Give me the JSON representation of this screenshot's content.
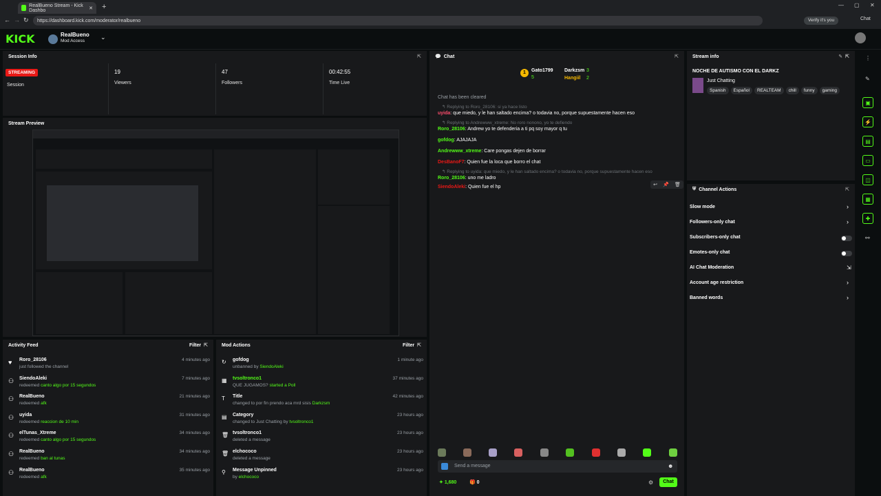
{
  "browser": {
    "tab_title": "RealBueno Stream - Kick Dashbo",
    "url": "https://dashboard.kick.com/moderator/realbueno",
    "verify": "Verify it's you",
    "chat_btn": "Chat"
  },
  "header": {
    "logo": "KICK",
    "channel": "RealBueno",
    "access": "Mod Access"
  },
  "session": {
    "title": "Session Info",
    "status": "STREAMING",
    "status_label": "Session",
    "viewers": "19",
    "viewers_label": "Viewers",
    "followers": "47",
    "followers_label": "Followers",
    "time": "00:42:55",
    "time_label": "Time Live"
  },
  "preview": {
    "title": "Stream Preview"
  },
  "activity": {
    "title": "Activity Feed",
    "filter": "Filter",
    "items": [
      {
        "user": "Roro_28106",
        "action": "just followed the channel",
        "reward": "",
        "time": "4 minutes ago"
      },
      {
        "user": "SiendoAleki",
        "action": "redeemed",
        "reward": "canto algo por 15 segundos",
        "time": "7 minutes ago"
      },
      {
        "user": "RealBueno",
        "action": "redeemed",
        "reward": "afk",
        "time": "21 minutes ago"
      },
      {
        "user": "uyida",
        "action": "redeemed",
        "reward": "reaccion de 10 min",
        "time": "31 minutes ago"
      },
      {
        "user": "elTunas_Xtreme",
        "action": "redeemed",
        "reward": "canto algo por 15 segundos",
        "time": "34 minutes ago"
      },
      {
        "user": "RealBueno",
        "action": "redeemed",
        "reward": "ban al tunas",
        "time": "34 minutes ago"
      },
      {
        "user": "RealBueno",
        "action": "redeemed",
        "reward": "afk",
        "time": "35 minutes ago"
      }
    ]
  },
  "mod": {
    "title": "Mod Actions",
    "filter": "Filter",
    "items": [
      {
        "user": "gofdog",
        "detail": "unbanned by",
        "who": "SiendoAleki",
        "time": "1 minute ago"
      },
      {
        "user": "tvsoltronco1",
        "detail": "QUE JUGAMOS?",
        "who": "started a Poll",
        "time": "37 minutes ago"
      },
      {
        "user": "Title",
        "detail": "changed to por fin prendo aca mrd sisis",
        "who": "Darkzsm",
        "time": "42 minutes ago"
      },
      {
        "user": "Category",
        "detail": "changed to Just Chatting by",
        "who": "tvsoltronco1",
        "time": "23 hours ago"
      },
      {
        "user": "tvsoltronco1",
        "detail": "deleted a message",
        "who": "",
        "time": "23 hours ago"
      },
      {
        "user": "elchococo",
        "detail": "deleted a message",
        "who": "",
        "time": "23 hours ago"
      },
      {
        "user": "Message Unpinned",
        "detail": "by",
        "who": "elchococo",
        "time": "23 hours ago"
      }
    ]
  },
  "chat": {
    "title": "Chat",
    "top": [
      {
        "name": "Gato1799",
        "count": "5"
      },
      {
        "name": "Darkzsm",
        "count": "3"
      },
      {
        "name": "Hangiil",
        "count": "2"
      }
    ],
    "messages": [
      {
        "reply": "",
        "user": "",
        "text": "Chat has been cleared"
      },
      {
        "reply": "Replying to Roro_28106: si ya hace listo",
        "user": "uyida",
        "text": ": que miedo, y le han saltado encima? o todavia no, porque supuestamente hacen eso"
      },
      {
        "reply": "Replying to Andrewww_xtreme: No roro nonono, yo te defiendo",
        "user": "Roro_28106",
        "text": ": Andrew yo te defenderia a ti pq soy mayor q tu"
      },
      {
        "reply": "",
        "user": "gofdog",
        "text": ": AJAJAJA"
      },
      {
        "reply": "",
        "user": "Andrewww_xtreme",
        "text": ": Care pongas dejen de borrar"
      },
      {
        "reply": "",
        "user": "DesBanoF7",
        "text": ": Quien fue la loca que borro el chat"
      },
      {
        "reply": "Replying to uyida: que miedo, y le han saltado encima? o todavia no, porque supuestamente hacen eso",
        "user": "Roro_28106",
        "text": ": uno me ladro"
      },
      {
        "reply": "",
        "user": "SiendoAleki",
        "text": ": Quien fue el hp"
      }
    ],
    "placeholder": "Send a message",
    "points": "1,680",
    "gifts": "0",
    "send": "Chat"
  },
  "stream_info": {
    "title": "Stream info",
    "stream_title": "NOCHE DE AUTISMO CON EL DARKZ",
    "category": "Just Chatting",
    "tags": [
      "Spanish",
      "Español",
      "REALTEAM",
      "chill",
      "funny",
      "gaming"
    ]
  },
  "channel_actions": {
    "title": "Channel Actions",
    "items": [
      "Slow mode",
      "Followers-only chat",
      "Subscribers-only chat",
      "Emotes-only chat",
      "AI Chat Moderation",
      "Account age restriction",
      "Banned words"
    ]
  },
  "colors": {
    "accent": "#53fc18",
    "streaming": "#e91916",
    "panel": "#18191b"
  }
}
